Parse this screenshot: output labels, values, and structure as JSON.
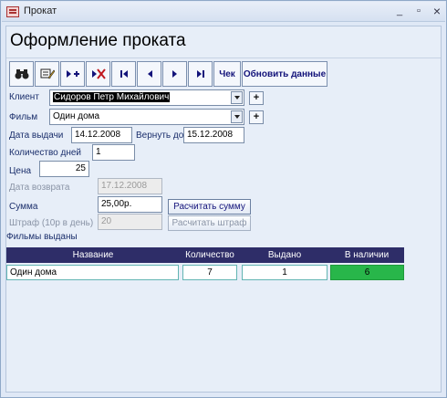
{
  "window": {
    "title": "Прокат",
    "minimize": "_",
    "restore": "▫",
    "close": "×"
  },
  "form": {
    "title": "Оформление проката"
  },
  "toolbar": {
    "buttons": [
      {
        "name": "find-record-button",
        "icon": "binoculars-icon",
        "label": ""
      },
      {
        "name": "edit-record-button",
        "icon": "edit-icon",
        "label": ""
      },
      {
        "name": "new-record-button",
        "icon": "new-record-icon",
        "label": ""
      },
      {
        "name": "delete-record-button",
        "icon": "delete-record-icon",
        "label": ""
      },
      {
        "name": "first-record-button",
        "icon": "first-icon",
        "label": ""
      },
      {
        "name": "prev-record-button",
        "icon": "prev-icon",
        "label": ""
      },
      {
        "name": "next-record-button",
        "icon": "next-icon",
        "label": ""
      },
      {
        "name": "last-record-button",
        "icon": "last-icon",
        "label": ""
      }
    ],
    "receipt_label": "Чек",
    "refresh_label": "Обновить данные"
  },
  "fields": {
    "client": {
      "label": "Клиент",
      "value": "Сидоров Петр Михайлович"
    },
    "film": {
      "label": "Фильм",
      "value": "Один дома"
    },
    "issue_date": {
      "label": "Дата выдачи",
      "value": "14.12.2008"
    },
    "return_by": {
      "label": "Вернуть до",
      "value": "15.12.2008"
    },
    "days": {
      "label": "Количество дней",
      "value": "1"
    },
    "price": {
      "label": "Цена",
      "value": "25"
    },
    "return_date": {
      "label": "Дата возврата",
      "value": "17.12.2008"
    },
    "sum": {
      "label": "Сумма",
      "value": "25,00р."
    },
    "fine": {
      "label": "Штраф (10р в день)",
      "value": "20"
    }
  },
  "actions": {
    "calc_sum": "Расчитать сумму",
    "calc_fine": "Расчитать штраф",
    "add_symbol": "+"
  },
  "issued": {
    "label": "Фильмы выданы",
    "columns": [
      "Название",
      "Количество",
      "Выдано",
      "В наличии"
    ],
    "rows": [
      {
        "title": "Один дома",
        "quantity": "7",
        "issued": "1",
        "available": "6"
      }
    ]
  },
  "colors": {
    "header": "#2e2d68",
    "available": "#28b64a",
    "accent": "#13137a"
  }
}
